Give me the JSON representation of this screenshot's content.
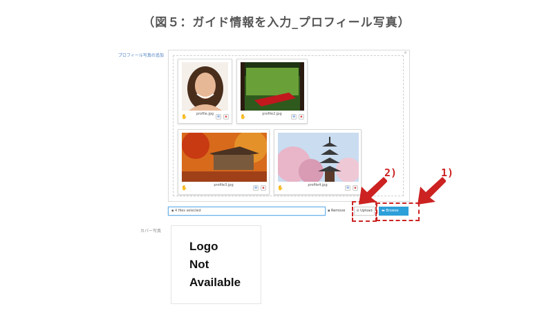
{
  "page_title": "（図５：ガイド情報を入力_プロフィール写真）",
  "profile_photo_label": "プロフィール写真の追加",
  "thumbnails": [
    {
      "caption": "profile.jpg",
      "image": "woman-portrait"
    },
    {
      "caption": "profile2.jpg",
      "image": "temple-garden-red-carpet"
    },
    {
      "caption": "profile3.jpg",
      "image": "autumn-temple"
    },
    {
      "caption": "profile4.jpg",
      "image": "pagoda-cherry-blossoms"
    }
  ],
  "file_input": {
    "value": "4 files selected"
  },
  "buttons": {
    "remove": "Remove",
    "upload": "Upload",
    "browse": "Browse"
  },
  "annotations": {
    "one": "1)",
    "two": "2)"
  },
  "cover_photo_label": "カバー写真",
  "logo_placeholder": {
    "line1": "Logo",
    "line2": "Not",
    "line3": "Available"
  },
  "colors": {
    "accent": "#2d9fd9",
    "annotation": "#cc2222",
    "link": "#4a7fc1"
  }
}
